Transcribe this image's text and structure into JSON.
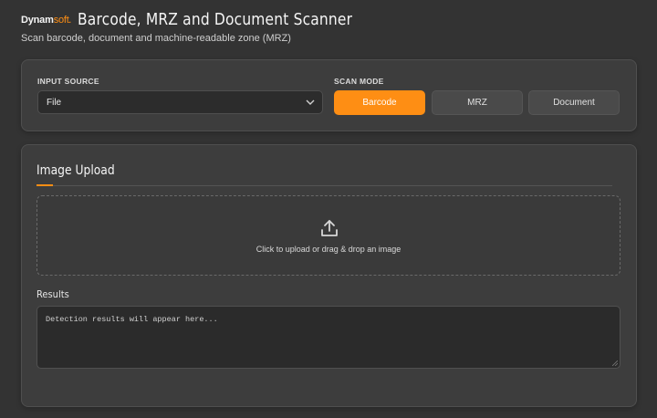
{
  "header": {
    "logo_main": "Dynam",
    "logo_accent": "soft",
    "title": "Barcode, MRZ and Document Scanner",
    "subtitle": "Scan barcode, document and machine-readable zone (MRZ)"
  },
  "controls": {
    "input_source_label": "INPUT SOURCE",
    "input_source_value": "File",
    "scan_mode_label": "SCAN MODE",
    "modes": [
      {
        "label": "Barcode",
        "active": true
      },
      {
        "label": "MRZ",
        "active": false
      },
      {
        "label": "Document",
        "active": false
      }
    ]
  },
  "upload_section": {
    "title": "Image Upload",
    "dropzone_text": "Click to upload or drag & drop an image",
    "upload_icon": "upload-icon"
  },
  "results": {
    "label": "Results",
    "placeholder": "Detection results will appear here..."
  },
  "colors": {
    "accent": "#fe8e14",
    "background": "#333333",
    "card": "#3d3d3d"
  }
}
